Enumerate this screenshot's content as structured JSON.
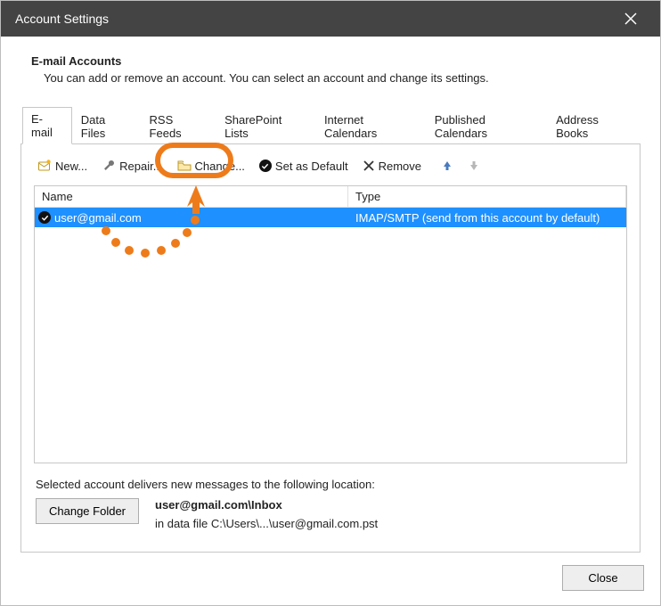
{
  "window": {
    "title": "Account Settings"
  },
  "header": {
    "section_title": "E-mail Accounts",
    "section_desc": "You can add or remove an account. You can select an account and change its settings."
  },
  "tabs": [
    {
      "label": "E-mail",
      "active": true
    },
    {
      "label": "Data Files"
    },
    {
      "label": "RSS Feeds"
    },
    {
      "label": "SharePoint Lists"
    },
    {
      "label": "Internet Calendars"
    },
    {
      "label": "Published Calendars"
    },
    {
      "label": "Address Books"
    }
  ],
  "toolbar": {
    "new_label": "New...",
    "repair_label": "Repair...",
    "change_label": "Change...",
    "set_default_label": "Set as Default",
    "remove_label": "Remove"
  },
  "columns": {
    "name": "Name",
    "type": "Type"
  },
  "accounts": [
    {
      "name": "user@gmail.com",
      "type": "IMAP/SMTP (send from this account by default)",
      "default": true,
      "selected": true
    }
  ],
  "delivery": {
    "text": "Selected account delivers new messages to the following location:",
    "change_folder_label": "Change Folder",
    "location_bold": "user@gmail.com\\Inbox",
    "datafile_text": "in data file C:\\Users\\...\\user@gmail.com.pst"
  },
  "footer": {
    "close_label": "Close"
  }
}
